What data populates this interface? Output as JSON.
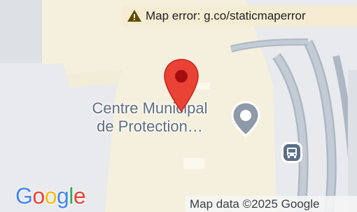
{
  "map": {
    "error_text": "Map error: g.co/staticmaperror",
    "place_label_line1": "Centre Municipal",
    "place_label_line2": "de Protection…",
    "attribution": "Map data ©2025 Google",
    "logo_letters": [
      "G",
      "o",
      "o",
      "g",
      "l",
      "e"
    ],
    "logo_colors": [
      "#4285F4",
      "#EA4335",
      "#FBBC05",
      "#4285F4",
      "#34A853",
      "#EA4335"
    ],
    "marker_icon": "red-location-pin",
    "poi_icon": "gray-place-marker",
    "transit_icon": "bus-stop",
    "colors": {
      "background": "#e8eaed",
      "building": "#f5f0dd",
      "road": "#aeb8c4",
      "marker_red": "#ea4335",
      "error_banner": "#f5ecd3"
    }
  }
}
